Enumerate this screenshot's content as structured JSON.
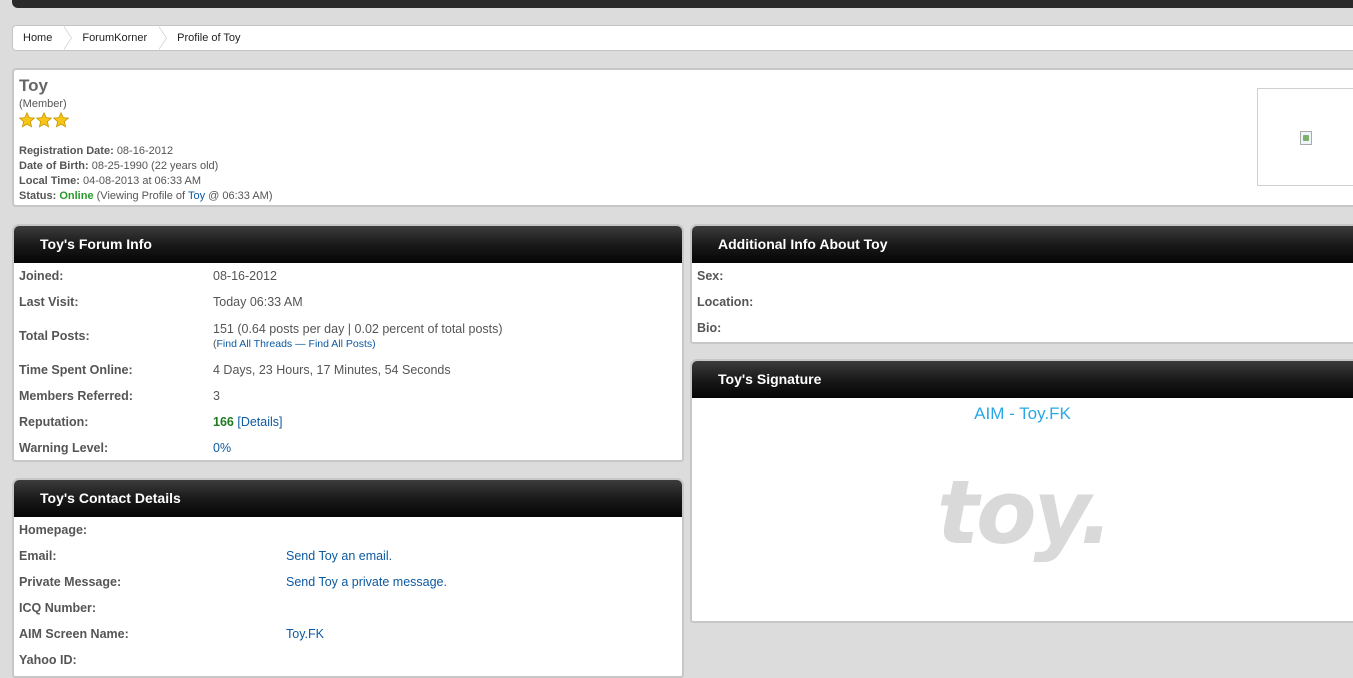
{
  "breadcrumb": [
    "Home",
    "ForumKorner",
    "Profile of Toy"
  ],
  "profile": {
    "name": "Toy",
    "role": "(Member)",
    "stars": 3,
    "registration_label": "Registration Date:",
    "registration_value": "08-16-2012",
    "dob_label": "Date of Birth:",
    "dob_value": "08-25-1990 (22 years old)",
    "localtime_label": "Local Time:",
    "localtime_value": "04-08-2013 at 06:33 AM",
    "status_label": "Status:",
    "status_value": "Online",
    "status_detail_prefix": "(Viewing Profile of",
    "status_detail_link": "Toy",
    "status_detail_suffix": "@ 06:33 AM)"
  },
  "forum_info": {
    "title": "Toy's Forum Info",
    "joined_label": "Joined:",
    "joined": "08-16-2012",
    "last_visit_label": "Last Visit:",
    "last_visit": "Today 06:33 AM",
    "total_posts_label": "Total Posts:",
    "total_posts": "151 (0.64 posts per day | 0.02 percent of total posts)",
    "find_threads": "Find All Threads",
    "find_sep": "—",
    "find_posts": "Find All Posts",
    "time_online_label": "Time Spent Online:",
    "time_online": "4 Days, 23 Hours, 17 Minutes, 54 Seconds",
    "referred_label": "Members Referred:",
    "referred": "3",
    "reputation_label": "Reputation:",
    "reputation": "166",
    "reputation_details": "[Details]",
    "warning_label": "Warning Level:",
    "warning": "0%"
  },
  "contact": {
    "title": "Toy's Contact Details",
    "homepage_label": "Homepage:",
    "email_label": "Email:",
    "email_link": "Send Toy an email.",
    "pm_label": "Private Message:",
    "pm_link": "Send Toy a private message.",
    "icq_label": "ICQ Number:",
    "aim_label": "AIM Screen Name:",
    "aim_value": "Toy.FK",
    "yahoo_label": "Yahoo ID:"
  },
  "additional": {
    "title": "Additional Info About Toy",
    "sex_label": "Sex:",
    "location_label": "Location:",
    "bio_label": "Bio:"
  },
  "signature": {
    "title": "Toy's Signature",
    "aim_text": "AIM - Toy.FK",
    "logo_text": "toy."
  },
  "colors": {
    "link": "#0d5aa1",
    "online": "#2a9a2a",
    "reputation": "#1f7a1f",
    "signature_aim": "#2aa7e6",
    "header_dark": "#1a1a1a"
  }
}
